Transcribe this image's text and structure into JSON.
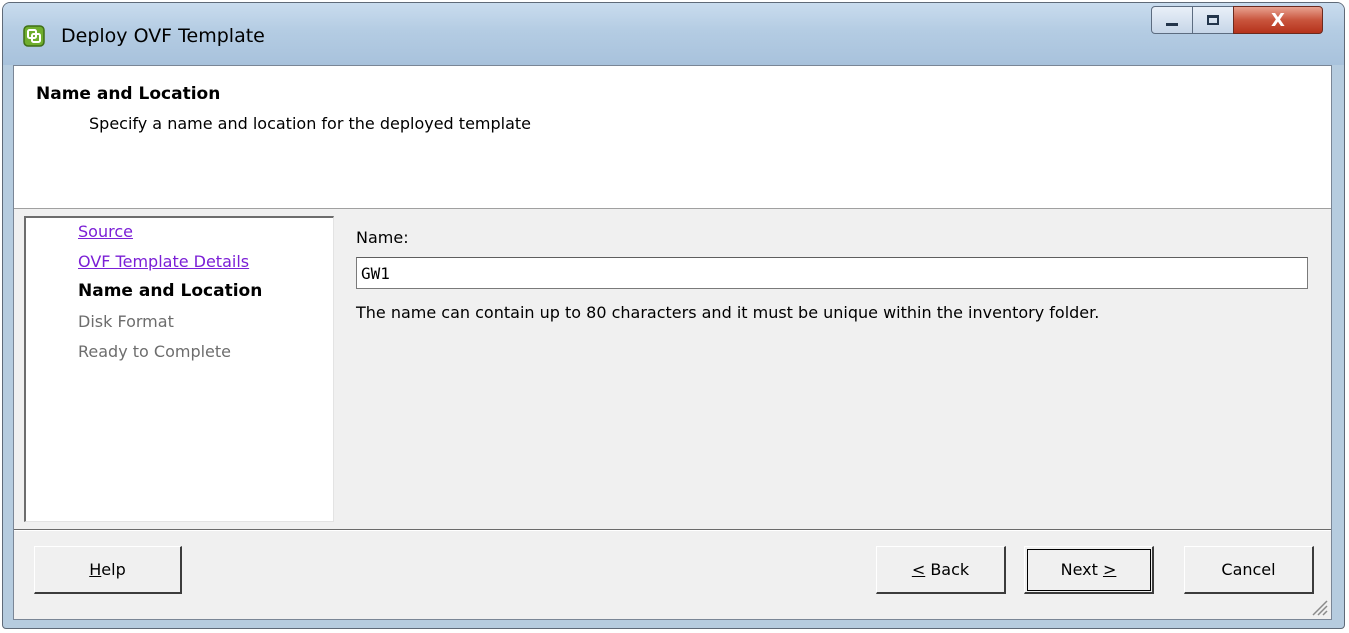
{
  "window": {
    "title": "Deploy OVF Template",
    "icon": "vsphere-app-icon",
    "controls": {
      "minimize": "minimize-icon",
      "maximize": "maximize-icon",
      "close_label": "X"
    }
  },
  "header": {
    "title": "Name and Location",
    "subtitle": "Specify a name and location for the deployed template"
  },
  "nav": {
    "items": [
      {
        "label": "Source",
        "state": "link"
      },
      {
        "label": "OVF Template Details",
        "state": "link"
      },
      {
        "label": "Name and Location",
        "state": "current"
      },
      {
        "label": "Disk Format",
        "state": "disabled"
      },
      {
        "label": "Ready to Complete",
        "state": "disabled"
      }
    ]
  },
  "form": {
    "name_label": "Name:",
    "name_value": "GW1",
    "hint": "The name can contain up to 80 characters and it must be unique within the inventory folder."
  },
  "buttons": {
    "help": {
      "mnemonic": "H",
      "rest": "elp"
    },
    "back": {
      "mnemonic": "<",
      "rest": " Back"
    },
    "next": {
      "prefix": "Next ",
      "mnemonic": ">"
    },
    "cancel": "Cancel"
  },
  "colors": {
    "link": "#7b1fd6",
    "disabled": "#6d6d6d",
    "title_bar": "#b6ccdf",
    "close_button": "#c9553d"
  }
}
